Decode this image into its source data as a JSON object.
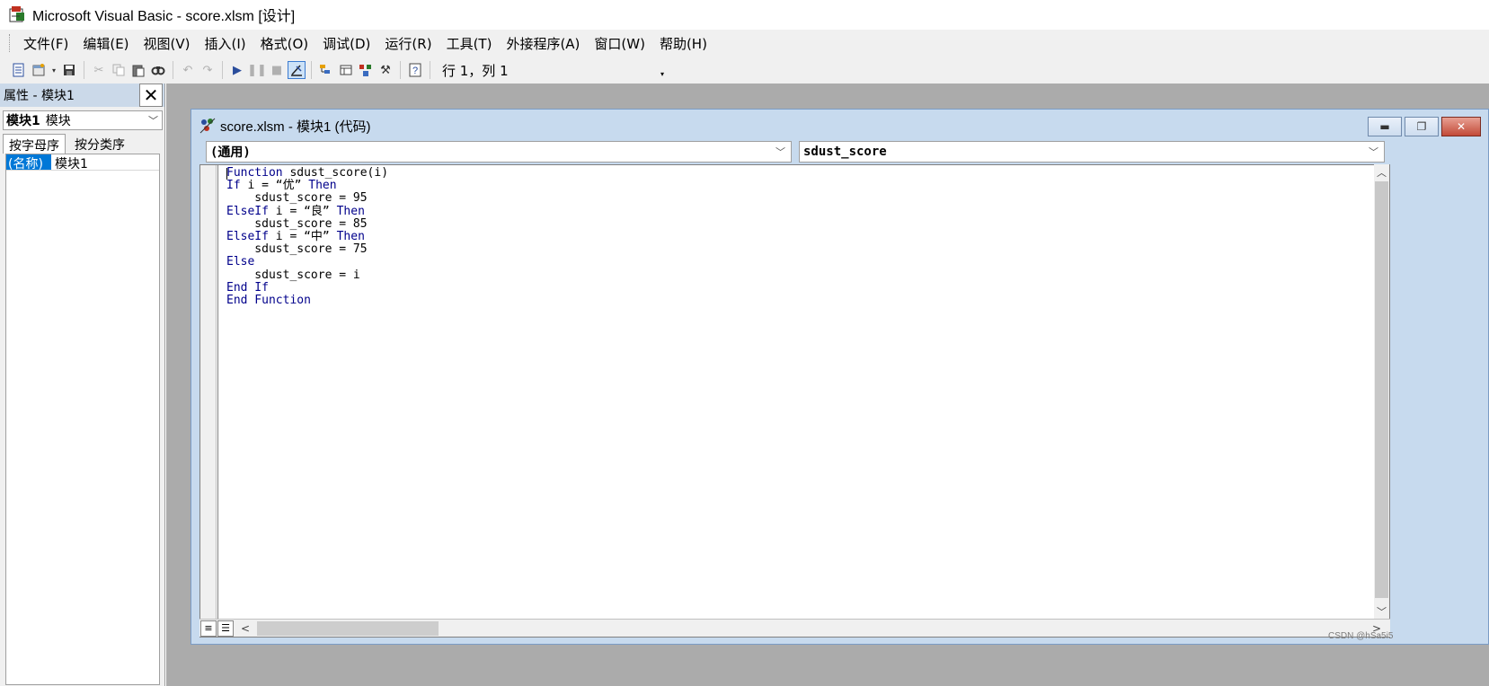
{
  "window": {
    "title": "Microsoft Visual Basic - score.xlsm [设计]",
    "icon": "vba-app-icon"
  },
  "menu": [
    {
      "label": "文件(F)"
    },
    {
      "label": "编辑(E)"
    },
    {
      "label": "视图(V)"
    },
    {
      "label": "插入(I)"
    },
    {
      "label": "格式(O)"
    },
    {
      "label": "调试(D)"
    },
    {
      "label": "运行(R)"
    },
    {
      "label": "工具(T)"
    },
    {
      "label": "外接程序(A)"
    },
    {
      "label": "窗口(W)"
    },
    {
      "label": "帮助(H)"
    }
  ],
  "toolbar": {
    "position": "行 1，列 1",
    "buttons": [
      "view-excel-icon",
      "insert-module-icon",
      "save-icon",
      "cut-icon",
      "copy-icon",
      "paste-icon",
      "find-icon",
      "undo-icon",
      "redo-icon",
      "run-icon",
      "break-icon",
      "reset-icon",
      "design-mode-icon",
      "project-explorer-icon",
      "properties-window-icon",
      "object-browser-icon",
      "toolbox-icon",
      "help-icon"
    ]
  },
  "properties": {
    "title": "属性 - 模块1",
    "object_name": "模块1",
    "object_type": "模块",
    "tabs": [
      "按字母序",
      "按分类序"
    ],
    "rows": [
      {
        "key": "(名称)",
        "value": "模块1"
      }
    ]
  },
  "code_window": {
    "title": "score.xlsm - 模块1 (代码)",
    "object_combo": "(通用)",
    "procedure_combo": "sdust_score",
    "lines": [
      {
        "kw": "Function",
        "text": " sdust_score(i)"
      },
      {
        "kw": "If",
        "text": " i = “优” ",
        "kw2": "Then"
      },
      {
        "kw": "",
        "text": "    sdust_score = 95"
      },
      {
        "kw": "ElseIf",
        "text": " i = “良” ",
        "kw2": "Then"
      },
      {
        "kw": "",
        "text": "    sdust_score = 85"
      },
      {
        "kw": "ElseIf",
        "text": " i = “中” ",
        "kw2": "Then"
      },
      {
        "kw": "",
        "text": "    sdust_score = 75"
      },
      {
        "kw": "Else",
        "text": ""
      },
      {
        "kw": "",
        "text": "    sdust_score = i"
      },
      {
        "kw": "End If",
        "text": ""
      },
      {
        "kw": "End Function",
        "text": ""
      }
    ]
  },
  "watermark": "CSDN @hSa5i5",
  "colors": {
    "keyword": "#00008b",
    "selection": "#0078d7",
    "mdi_background": "#ababab",
    "window_frame": "#c7daee"
  }
}
